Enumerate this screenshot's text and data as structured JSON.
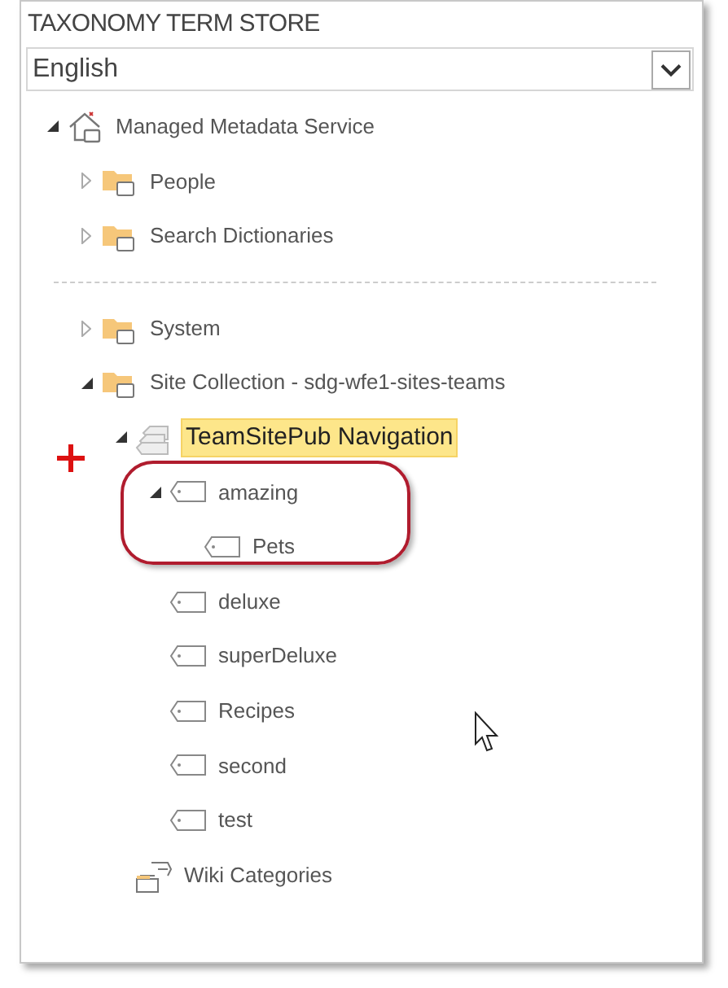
{
  "panel": {
    "title": "TAXONOMY TERM STORE",
    "language": {
      "value": "English"
    }
  },
  "tree": [
    {
      "kind": "service",
      "label": "Managed Metadata Service",
      "expanded": true,
      "selected": false,
      "children": [
        {
          "kind": "group",
          "label": "People",
          "expanded": false,
          "selected": false
        },
        {
          "kind": "group",
          "label": "Search Dictionaries",
          "expanded": false,
          "selected": false
        },
        {
          "kind": "group",
          "label": "System",
          "expanded": false,
          "selected": false,
          "divider_before": true
        },
        {
          "kind": "group",
          "label": "Site Collection - sdg-wfe1-sites-teams",
          "expanded": true,
          "selected": false,
          "children": [
            {
              "kind": "termset",
              "label": "TeamSitePub Navigation",
              "expanded": true,
              "selected": true,
              "children": [
                {
                  "kind": "term",
                  "label": "amazing",
                  "expanded": true,
                  "selected": false,
                  "children": [
                    {
                      "kind": "term",
                      "label": "Pets",
                      "selected": false
                    }
                  ]
                },
                {
                  "kind": "term",
                  "label": "deluxe",
                  "selected": false
                },
                {
                  "kind": "term",
                  "label": "superDeluxe",
                  "selected": false
                },
                {
                  "kind": "term",
                  "label": "Recipes",
                  "selected": false
                },
                {
                  "kind": "term",
                  "label": "second",
                  "selected": false
                },
                {
                  "kind": "term",
                  "label": "test",
                  "selected": false
                }
              ]
            },
            {
              "kind": "wiki",
              "label": "Wiki Categories",
              "selected": false
            }
          ]
        }
      ]
    }
  ],
  "annotations": [
    {
      "kind": "plus"
    },
    {
      "kind": "outline"
    },
    {
      "kind": "cursor"
    }
  ]
}
